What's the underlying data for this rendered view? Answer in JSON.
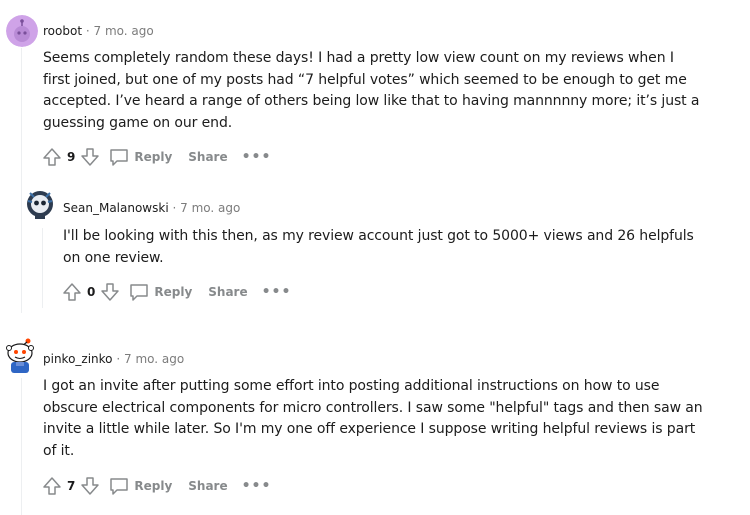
{
  "comments": [
    {
      "username": "roobot",
      "separator": "·",
      "time": "7 mo. ago",
      "body": "Seems completely random these days! I had a pretty low view count on my reviews when I first joined, but one of my posts had “7 helpful votes” which seemed to be enough to get me accepted. I’ve heard a range of others being low like that to having mannnnny more; it’s just a guessing game on our end.",
      "votes": "9",
      "reply_label": "Reply",
      "share_label": "Share",
      "more_label": "•••"
    },
    {
      "username": "Sean_Malanowski",
      "separator": "·",
      "time": "7 mo. ago",
      "body": "I'll be looking with this then, as my review account just got to 5000+ views and 26 helpfuls on one review.",
      "votes": "0",
      "reply_label": "Reply",
      "share_label": "Share",
      "more_label": "•••"
    },
    {
      "username": "pinko_zinko",
      "separator": "·",
      "time": "7 mo. ago",
      "body": "I got an invite after putting some effort into posting additional instructions on how to use obscure electrical components for micro controllers. I saw some \"helpful\" tags and then saw an invite a little while later. So I'm my one off experience I suppose writing helpful reviews is part of it.",
      "votes": "7",
      "reply_label": "Reply",
      "share_label": "Share",
      "more_label": "•••"
    }
  ],
  "colors": {
    "meta_gray": "#7c7c7c",
    "action_gray": "#878a8c",
    "thread_line": "#edeff1"
  },
  "icons": [
    "upvote-icon",
    "downvote-icon",
    "comment-bubble-icon",
    "snoo-avatar-icon",
    "robot-avatar-icon"
  ]
}
